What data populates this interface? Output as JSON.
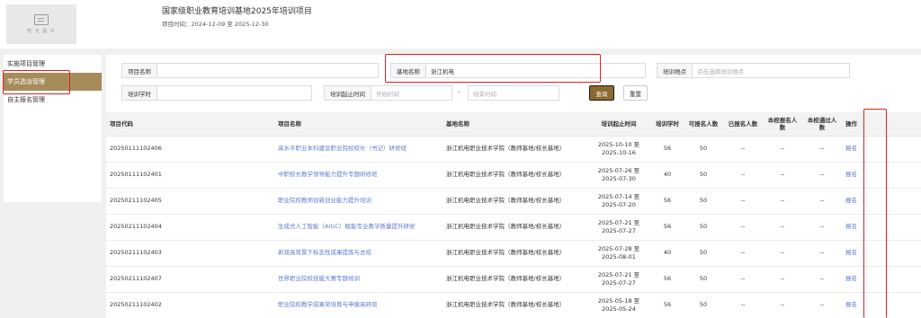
{
  "header": {
    "logo_text": "暂 无 图 片",
    "title": "国家级职业教育培训基地2025年培训项目",
    "time_label": "项目时间：2024-12-09 至 2025-12-30"
  },
  "sidebar": {
    "items": [
      {
        "label": "实施项目管理"
      },
      {
        "label": "学员选派管理"
      },
      {
        "label": "自主报名管理"
      }
    ]
  },
  "filters": {
    "project_name": {
      "label": "项目名称",
      "value": ""
    },
    "base_name": {
      "label": "基地名称",
      "value": "浙江机电"
    },
    "location": {
      "label": "培训地点",
      "placeholder": "点击选择培训地点"
    },
    "hours": {
      "label": "培训学时",
      "value": ""
    },
    "period": {
      "label": "培训起止时间",
      "start_placeholder": "开始时间",
      "separator": "-",
      "end_placeholder": "结束时间"
    },
    "query_label": "查询",
    "reset_label": "重置"
  },
  "table": {
    "columns": [
      "项目代码",
      "项目名称",
      "基地名称",
      "培训起止时间",
      "培训学时",
      "可报名人数",
      "已报名人数",
      "本校报名人数",
      "本校通过人数",
      "操作"
    ],
    "rows": [
      {
        "code": "20250111102406",
        "name": "高水平职业本科建设职业院校校长（书记）研修班",
        "base": "浙江机电职业技术学院（教师基地/校长基地）",
        "start": "2025-10-10 至",
        "end": "2025-10-16",
        "hours": "56",
        "capacity": "50",
        "enrolled": "--",
        "school_enrolled": "--",
        "school_passed": "--",
        "action": "报名"
      },
      {
        "code": "20250111102401",
        "name": "中职校长教学领导能力提升专题研修班",
        "base": "浙江机电职业技术学院（教师基地/校长基地）",
        "start": "2025-07-26 至",
        "end": "2025-07-30",
        "hours": "40",
        "capacity": "50",
        "enrolled": "--",
        "school_enrolled": "--",
        "school_passed": "--",
        "action": "报名"
      },
      {
        "code": "20250211102405",
        "name": "职业院校教师创新创业能力提升培训",
        "base": "浙江机电职业技术学院（教师基地/校长基地）",
        "start": "2025-07-14 至",
        "end": "2025-07-20",
        "hours": "56",
        "capacity": "50",
        "enrolled": "--",
        "school_enrolled": "--",
        "school_passed": "--",
        "action": "报名"
      },
      {
        "code": "20250211102404",
        "name": "生成式人工智能（AIGC）赋能专业教学质量提升研修",
        "base": "浙江机电职业技术学院（教师基地/校长基地）",
        "start": "2025-07-21 至",
        "end": "2025-07-27",
        "hours": "56",
        "capacity": "50",
        "enrolled": "--",
        "school_enrolled": "--",
        "school_passed": "--",
        "action": "报名"
      },
      {
        "code": "20250211102403",
        "name": "新双高背景下标志性成果提炼与总结",
        "base": "浙江机电职业技术学院（教师基地/校长基地）",
        "start": "2025-07-28 至",
        "end": "2025-08-01",
        "hours": "40",
        "capacity": "50",
        "enrolled": "--",
        "school_enrolled": "--",
        "school_passed": "--",
        "action": "报名"
      },
      {
        "code": "20250211102407",
        "name": "世界职业院校技能大赛专题培训",
        "base": "浙江机电职业技术学院（教师基地/校长基地）",
        "start": "2025-07-21 至",
        "end": "2025-07-27",
        "hours": "56",
        "capacity": "50",
        "enrolled": "--",
        "school_enrolled": "--",
        "school_passed": "--",
        "action": "报名"
      },
      {
        "code": "20250211102402",
        "name": "职业院校教学成果奖培育与申报高研班",
        "base": "浙江机电职业技术学院（教师基地/校长基地）",
        "start": "2025-05-18 至",
        "end": "2025-05-24",
        "hours": "56",
        "capacity": "50",
        "enrolled": "--",
        "school_enrolled": "--",
        "school_passed": "--",
        "action": "报名"
      }
    ]
  },
  "colors": {
    "accent": "#a68b5b",
    "query_button": "#8a6a2e",
    "link": "#5b7ccc",
    "highlight_box": "#e02020"
  }
}
